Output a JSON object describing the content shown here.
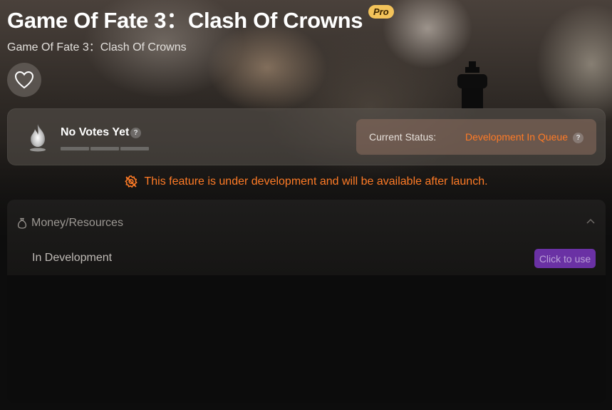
{
  "header": {
    "title": "Game Of Fate 3：Clash Of Crowns",
    "pro_badge": "Pro",
    "subtitle": "Game Of Fate 3：Clash Of Crowns",
    "favorite_icon": "heart-icon"
  },
  "votes": {
    "label": "No Votes Yet",
    "help": "?",
    "icon": "flame-icon",
    "level": 0
  },
  "status": {
    "label": "Current Status:",
    "value": "Development In Queue",
    "help": "?",
    "value_color": "#ff7b26"
  },
  "notice": {
    "icon": "settings-gear-icon",
    "text": "This feature is under development and will be available after launch."
  },
  "section": {
    "icon": "money-bag-icon",
    "title": "Money/Resources",
    "collapse_icon": "chevron-up-icon",
    "items": [
      {
        "label": "In Development",
        "button": "Click to use"
      }
    ]
  },
  "colors": {
    "accent_orange": "#ff7b26",
    "pro_gold": "#f3c35a",
    "button_purple": "#6a31a4"
  }
}
